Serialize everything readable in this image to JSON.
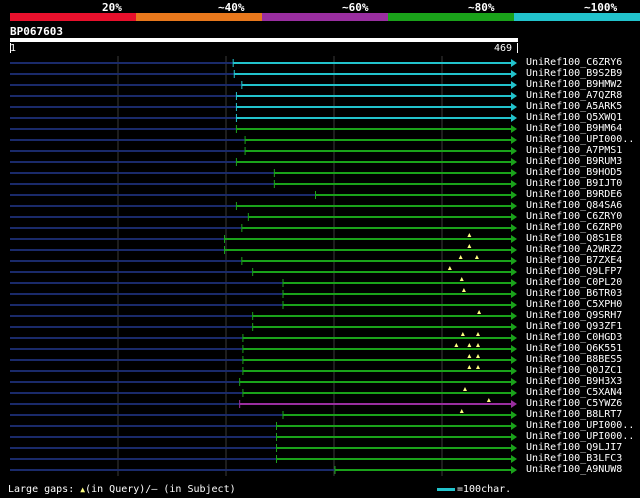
{
  "legend": {
    "labels": [
      "20%",
      "~40%",
      "~60%",
      "~80%",
      "~100%"
    ],
    "colors": [
      "#e8102c",
      "#e8781c",
      "#9a2ea0",
      "#1aa21a",
      "#22c3cc"
    ]
  },
  "query": {
    "id": "BP067603",
    "start": "1",
    "end": "469",
    "length": 469
  },
  "hits": [
    {
      "label": "UniRef100_C6ZRY6",
      "start": 207,
      "end": 469,
      "color": "cyan",
      "gaps": []
    },
    {
      "label": "UniRef100_B9S2B9",
      "start": 208,
      "end": 469,
      "color": "cyan",
      "gaps": []
    },
    {
      "label": "UniRef100_B9HMW2",
      "start": 215,
      "end": 469,
      "color": "cyan",
      "gaps": []
    },
    {
      "label": "UniRef100_A7QZR8",
      "start": 210,
      "end": 469,
      "color": "cyan",
      "gaps": []
    },
    {
      "label": "UniRef100_A5ARK5",
      "start": 210,
      "end": 469,
      "color": "cyan",
      "gaps": []
    },
    {
      "label": "UniRef100_Q5XWQ1",
      "start": 210,
      "end": 469,
      "color": "cyan",
      "gaps": []
    },
    {
      "label": "UniRef100_B9HM64",
      "start": 210,
      "end": 469,
      "color": "green",
      "gaps": []
    },
    {
      "label": "UniRef100_UPI000..",
      "start": 218,
      "end": 469,
      "color": "green",
      "gaps": []
    },
    {
      "label": "UniRef100_A7PMS1",
      "start": 218,
      "end": 469,
      "color": "green",
      "gaps": []
    },
    {
      "label": "UniRef100_B9RUM3",
      "start": 210,
      "end": 469,
      "color": "green",
      "gaps": []
    },
    {
      "label": "UniRef100_B9HOD5",
      "start": 245,
      "end": 469,
      "color": "green",
      "gaps": []
    },
    {
      "label": "UniRef100_B9IJT0",
      "start": 245,
      "end": 469,
      "color": "green",
      "gaps": []
    },
    {
      "label": "UniRef100_B9RDE6",
      "start": 283,
      "end": 469,
      "color": "green",
      "gaps": []
    },
    {
      "label": "UniRef100_Q84SA6",
      "start": 210,
      "end": 469,
      "color": "green",
      "gaps": []
    },
    {
      "label": "UniRef100_C6ZRY0",
      "start": 221,
      "end": 469,
      "color": "green",
      "gaps": []
    },
    {
      "label": "UniRef100_C6ZRP0",
      "start": 215,
      "end": 469,
      "color": "green",
      "gaps": []
    },
    {
      "label": "UniRef100_Q8S1E8",
      "start": 199,
      "end": 469,
      "color": "green",
      "gaps": [
        425
      ]
    },
    {
      "label": "UniRef100_A2WRZ2",
      "start": 199,
      "end": 469,
      "color": "green",
      "gaps": [
        425
      ]
    },
    {
      "label": "UniRef100_B7ZXE4",
      "start": 215,
      "end": 469,
      "color": "green",
      "gaps": [
        417,
        432
      ]
    },
    {
      "label": "UniRef100_Q9LFP7",
      "start": 225,
      "end": 469,
      "color": "green",
      "gaps": [
        407
      ]
    },
    {
      "label": "UniRef100_C0PL20",
      "start": 253,
      "end": 469,
      "color": "green",
      "gaps": [
        418
      ]
    },
    {
      "label": "UniRef100_B6TR03",
      "start": 253,
      "end": 469,
      "color": "green",
      "gaps": [
        420
      ]
    },
    {
      "label": "UniRef100_C5XPH0",
      "start": 253,
      "end": 469,
      "color": "green",
      "gaps": []
    },
    {
      "label": "UniRef100_Q9SRH7",
      "start": 225,
      "end": 469,
      "color": "green",
      "gaps": [
        434
      ]
    },
    {
      "label": "UniRef100_Q93ZF1",
      "start": 225,
      "end": 469,
      "color": "green",
      "gaps": []
    },
    {
      "label": "UniRef100_C0HGD3",
      "start": 216,
      "end": 469,
      "color": "green",
      "gaps": [
        419,
        433
      ]
    },
    {
      "label": "UniRef100_Q6K551",
      "start": 216,
      "end": 469,
      "color": "green",
      "gaps": [
        413,
        425,
        433
      ]
    },
    {
      "label": "UniRef100_B8BES5",
      "start": 216,
      "end": 469,
      "color": "green",
      "gaps": [
        425,
        433
      ]
    },
    {
      "label": "UniRef100_Q0JZC1",
      "start": 216,
      "end": 469,
      "color": "green",
      "gaps": [
        425,
        433
      ]
    },
    {
      "label": "UniRef100_B9H3X3",
      "start": 213,
      "end": 469,
      "color": "green",
      "gaps": []
    },
    {
      "label": "UniRef100_C5XAN4",
      "start": 216,
      "end": 469,
      "color": "green",
      "gaps": [
        421
      ]
    },
    {
      "label": "UniRef100_C5YWZ6",
      "start": 213,
      "end": 469,
      "color": "purple",
      "gaps": [
        443
      ]
    },
    {
      "label": "UniRef100_B8LRT7",
      "start": 253,
      "end": 469,
      "color": "green",
      "gaps": [
        418
      ]
    },
    {
      "label": "UniRef100_UPI000..",
      "start": 247,
      "end": 469,
      "color": "green",
      "gaps": []
    },
    {
      "label": "UniRef100_UPI000..",
      "start": 247,
      "end": 469,
      "color": "green",
      "gaps": []
    },
    {
      "label": "UniRef100_Q9LJI7",
      "start": 247,
      "end": 469,
      "color": "green",
      "gaps": []
    },
    {
      "label": "UniRef100_B3LFC3",
      "start": 247,
      "end": 469,
      "color": "green",
      "gaps": []
    },
    {
      "label": "UniRef100_A9NUW8",
      "start": 301,
      "end": 469,
      "color": "green",
      "gaps": []
    }
  ],
  "footer": {
    "large_gaps_prefix": "Large gaps:",
    "in_query": "(in Query)/",
    "in_subject": "— (in Subject)",
    "scale_text": "=100char."
  }
}
